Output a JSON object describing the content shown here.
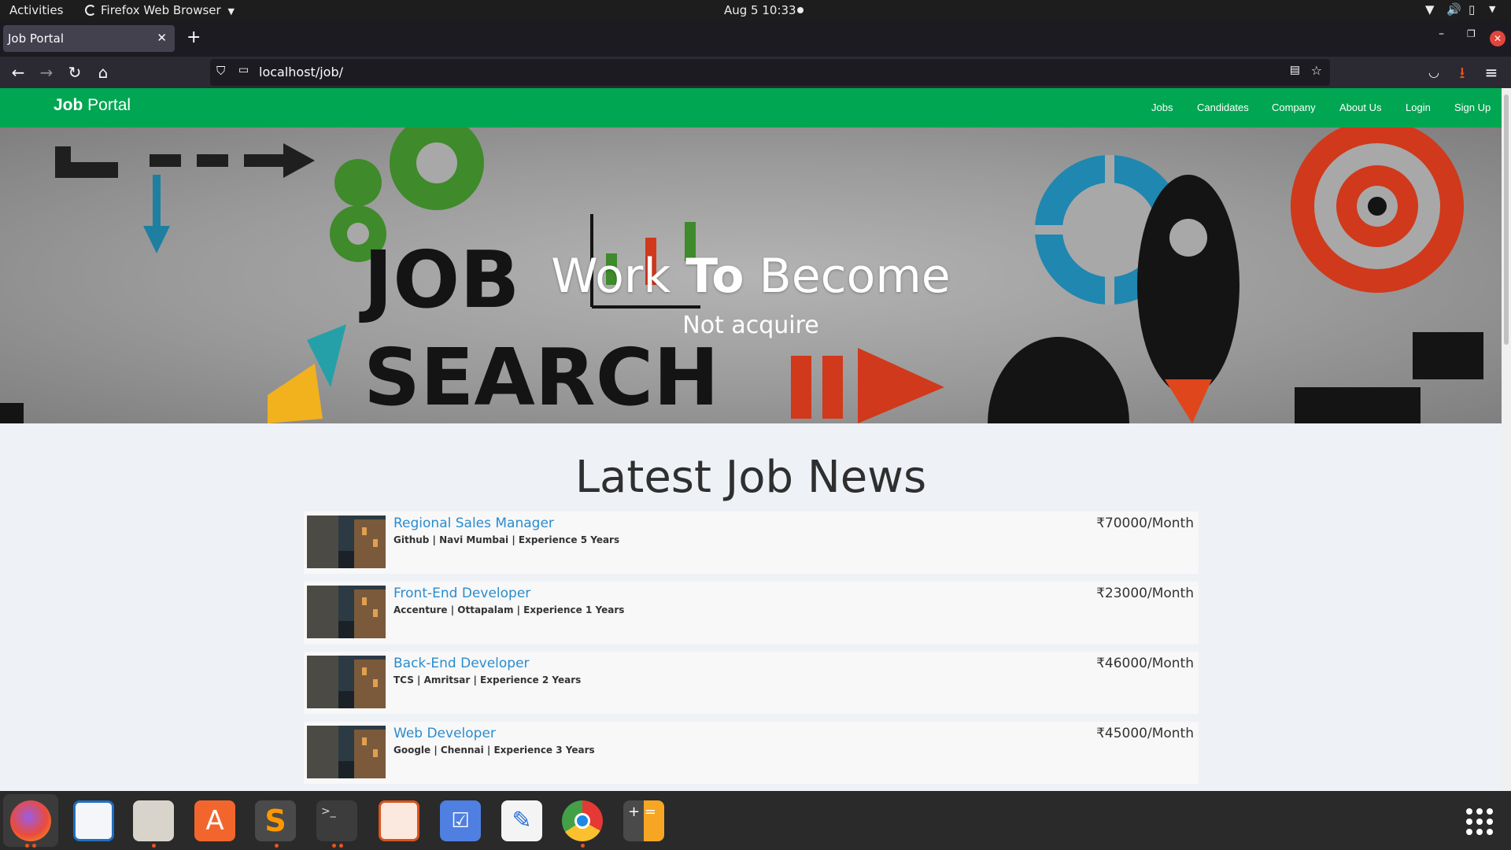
{
  "system_bar": {
    "activities": "Activities",
    "app_menu": "Firefox Web Browser",
    "clock": "Aug 5  10:33"
  },
  "browser": {
    "tab_title": "Job Portal",
    "url": "localhost/job/"
  },
  "site": {
    "brand_bold": "Job",
    "brand_rest": " Portal",
    "nav": [
      "Jobs",
      "Candidates",
      "Company",
      "About Us",
      "Login",
      "Sign Up"
    ],
    "hero": {
      "title_part1": "Work ",
      "title_bold": "To",
      "title_part2": " Become",
      "subtitle": "Not acquire",
      "image_words": [
        "JOB",
        "SEARCH"
      ]
    },
    "section_title": "Latest Job News",
    "jobs": [
      {
        "title": "Regional Sales Manager",
        "meta": "Github | Navi Mumbai | Experience 5 Years",
        "salary": "₹70000/Month"
      },
      {
        "title": "Front-End Developer",
        "meta": "Accenture | Ottapalam | Experience 1 Years",
        "salary": "₹23000/Month"
      },
      {
        "title": "Back-End Developer",
        "meta": "TCS | Amritsar | Experience 2 Years",
        "salary": "₹46000/Month"
      },
      {
        "title": "Web Developer",
        "meta": "Google | Chennai | Experience 3 Years",
        "salary": "₹45000/Month"
      }
    ]
  },
  "dock": {
    "apps": [
      "firefox-icon",
      "writer-icon",
      "files-icon",
      "app-center-icon",
      "sublime-text-icon",
      "terminal-icon",
      "impress-icon",
      "todo-icon",
      "text-editor-icon",
      "chrome-icon",
      "calculator-icon"
    ],
    "show_apps_icon": "app-grid-icon"
  },
  "colors": {
    "site_green": "#00a651",
    "link_blue": "#2a8ccf",
    "dock_bg": "#2a2a2a",
    "close_red": "#e0463c"
  }
}
